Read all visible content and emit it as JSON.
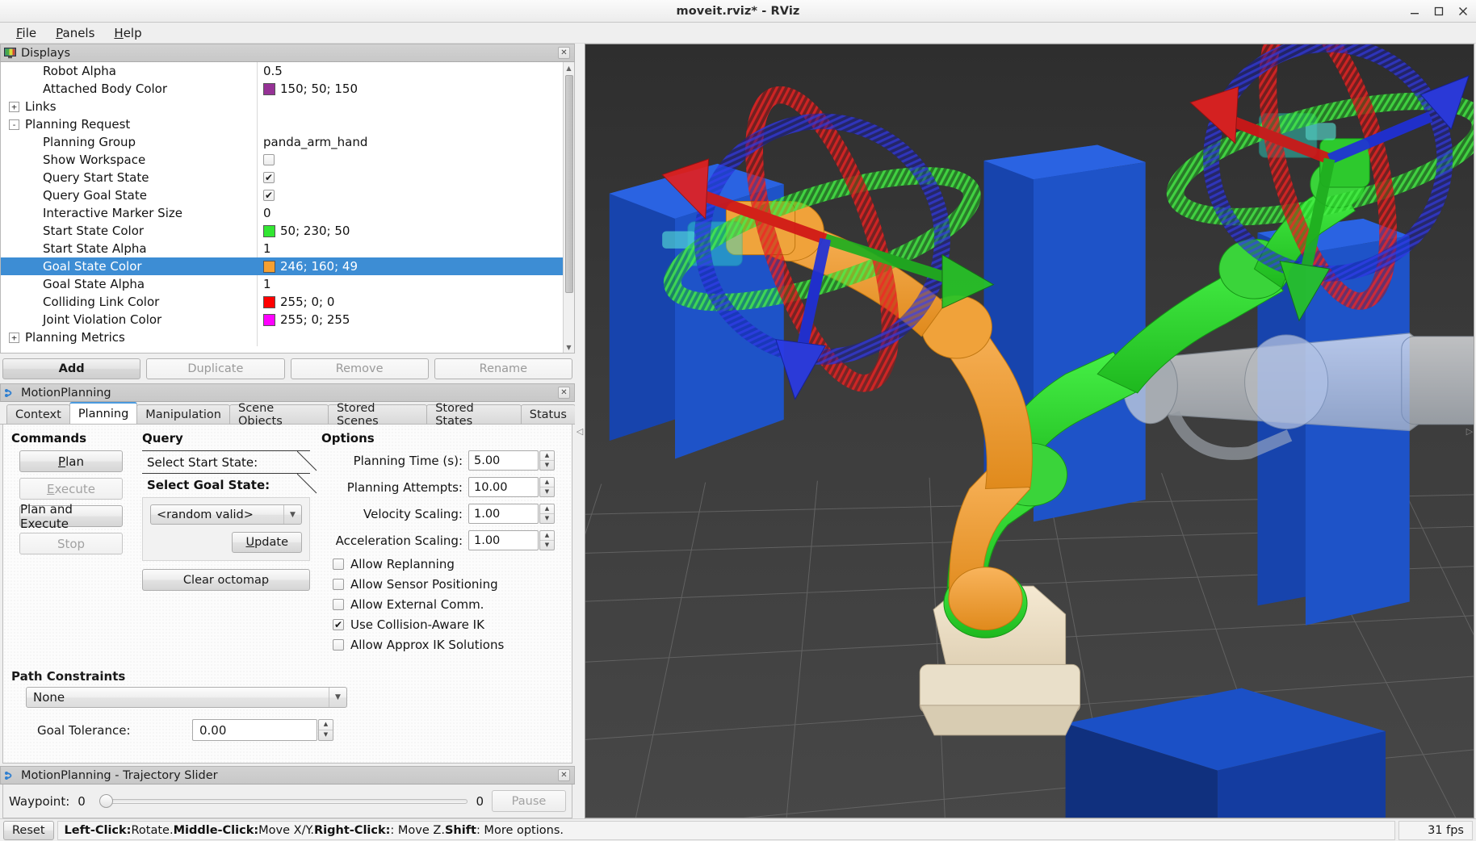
{
  "window": {
    "title": "moveit.rviz* - RViz",
    "minimize_icon": "minimize-icon",
    "maximize_icon": "maximize-icon",
    "close_icon": "close-icon"
  },
  "menubar": {
    "items": [
      {
        "label": "File",
        "mnemonic": "F"
      },
      {
        "label": "Panels",
        "mnemonic": "P"
      },
      {
        "label": "Help",
        "mnemonic": "H"
      }
    ]
  },
  "displays_panel": {
    "title": "Displays",
    "icon": "display-monitor-icon",
    "close_icon": "close-icon",
    "rows": [
      {
        "name": "Robot Alpha",
        "indent": 1,
        "expander": "",
        "value": "0.5",
        "value_type": "text"
      },
      {
        "name": "Attached Body Color",
        "indent": 1,
        "expander": "",
        "value": "150; 50; 150",
        "value_type": "color",
        "color": "#963296"
      },
      {
        "name": "Links",
        "indent": 0,
        "expander": "+",
        "value": "",
        "value_type": "none"
      },
      {
        "name": "Planning Request",
        "indent": 0,
        "expander": "-",
        "value": "",
        "value_type": "none"
      },
      {
        "name": "Planning Group",
        "indent": 1,
        "expander": "",
        "value": "panda_arm_hand",
        "value_type": "text"
      },
      {
        "name": "Show Workspace",
        "indent": 1,
        "expander": "",
        "value": "",
        "value_type": "checkbox",
        "checked": false
      },
      {
        "name": "Query Start State",
        "indent": 1,
        "expander": "",
        "value": "",
        "value_type": "checkbox",
        "checked": true
      },
      {
        "name": "Query Goal State",
        "indent": 1,
        "expander": "",
        "value": "",
        "value_type": "checkbox",
        "checked": true
      },
      {
        "name": "Interactive Marker Size",
        "indent": 1,
        "expander": "",
        "value": "0",
        "value_type": "text"
      },
      {
        "name": "Start State Color",
        "indent": 1,
        "expander": "",
        "value": "50; 230; 50",
        "value_type": "color",
        "color": "#32e632"
      },
      {
        "name": "Start State Alpha",
        "indent": 1,
        "expander": "",
        "value": "1",
        "value_type": "text"
      },
      {
        "name": "Goal State Color",
        "indent": 1,
        "expander": "",
        "value": "246; 160; 49",
        "value_type": "color",
        "color": "#f6a031",
        "selected": true
      },
      {
        "name": "Goal State Alpha",
        "indent": 1,
        "expander": "",
        "value": "1",
        "value_type": "text"
      },
      {
        "name": "Colliding Link Color",
        "indent": 1,
        "expander": "",
        "value": "255; 0; 0",
        "value_type": "color",
        "color": "#ff0000"
      },
      {
        "name": "Joint Violation Color",
        "indent": 1,
        "expander": "",
        "value": "255; 0; 255",
        "value_type": "color",
        "color": "#ff00ff"
      },
      {
        "name": "Planning Metrics",
        "indent": 0,
        "expander": "+",
        "value": "",
        "value_type": "none"
      }
    ],
    "buttons": [
      {
        "label": "Add",
        "enabled": true
      },
      {
        "label": "Duplicate",
        "enabled": false
      },
      {
        "label": "Remove",
        "enabled": false
      },
      {
        "label": "Rename",
        "enabled": false
      }
    ]
  },
  "motion_planning_panel": {
    "title": "MotionPlanning",
    "icon": "moveit-icon",
    "close_icon": "close-icon",
    "tabs": [
      {
        "label": "Context",
        "active": false
      },
      {
        "label": "Planning",
        "active": true
      },
      {
        "label": "Manipulation",
        "active": false
      },
      {
        "label": "Scene Objects",
        "active": false
      },
      {
        "label": "Stored Scenes",
        "active": false
      },
      {
        "label": "Stored States",
        "active": false
      },
      {
        "label": "Status",
        "active": false
      }
    ],
    "commands": {
      "title": "Commands",
      "buttons": [
        {
          "label": "Plan",
          "mnemonic": "P",
          "enabled": true
        },
        {
          "label": "Execute",
          "mnemonic": "E",
          "enabled": false
        },
        {
          "label": "Plan and Execute",
          "mnemonic": "",
          "enabled": true
        },
        {
          "label": "Stop",
          "mnemonic": "",
          "enabled": false
        }
      ]
    },
    "query": {
      "title": "Query",
      "start_state_header": "Select Start State:",
      "goal_state_header": "Select Goal State:",
      "goal_state_combo_value": "<random valid>",
      "update_label": "Update",
      "update_mnemonic": "U",
      "clear_octomap_label": "Clear octomap"
    },
    "options": {
      "title": "Options",
      "fields": [
        {
          "label": "Planning Time (s):",
          "value": "5.00"
        },
        {
          "label": "Planning Attempts:",
          "value": "10.00"
        },
        {
          "label": "Velocity Scaling:",
          "value": "1.00"
        },
        {
          "label": "Acceleration Scaling:",
          "value": "1.00"
        }
      ],
      "checkboxes": [
        {
          "label": "Allow Replanning",
          "checked": false
        },
        {
          "label": "Allow Sensor Positioning",
          "checked": false
        },
        {
          "label": "Allow External Comm.",
          "checked": false
        },
        {
          "label": "Use Collision-Aware IK",
          "checked": true
        },
        {
          "label": "Allow Approx IK Solutions",
          "checked": false
        }
      ]
    },
    "path_constraints": {
      "title": "Path Constraints",
      "selected": "None",
      "goal_tolerance_label": "Goal Tolerance:",
      "goal_tolerance_value": "0.00"
    }
  },
  "trajectory_slider": {
    "title": "MotionPlanning - Trajectory Slider",
    "icon": "moveit-icon",
    "close_icon": "close-icon",
    "waypoint_label": "Waypoint:",
    "waypoint_value": "0",
    "max_value": "0",
    "pause_label": "Pause"
  },
  "statusbar": {
    "reset_label": "Reset",
    "hint_segments": [
      {
        "text": "Left-Click:",
        "bold": true
      },
      {
        "text": " Rotate. ",
        "bold": false
      },
      {
        "text": "Middle-Click:",
        "bold": true
      },
      {
        "text": " Move X/Y. ",
        "bold": false
      },
      {
        "text": "Right-Click:",
        "bold": true
      },
      {
        "text": ": Move Z. ",
        "bold": false
      },
      {
        "text": "Shift",
        "bold": true
      },
      {
        "text": ": More options.",
        "bold": false
      }
    ],
    "hint_plain": "Left-Click: Rotate. Middle-Click: Move X/Y. Right-Click:: Move Z. Shift: More options.",
    "fps": "31 fps"
  },
  "viewport": {
    "name": "3d-render-view",
    "background_color": "#3b3b3b",
    "grid_color": "#6f6f6f",
    "colors": {
      "box_blue": "#1f58d8",
      "box_blue_dark": "#14307f",
      "start_state_green": "#32e632",
      "goal_state_orange": "#f6a031",
      "robot_grey": "#d8dce2",
      "marker_red": "#e02020",
      "marker_green": "#20c020",
      "marker_blue": "#2020e0",
      "gripper_cyan": "#28d8c8"
    }
  }
}
